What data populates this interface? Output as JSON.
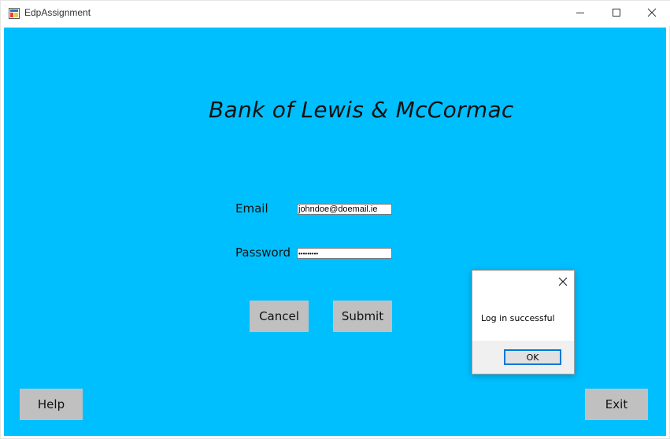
{
  "window": {
    "title": "EdpAssignment",
    "icon": "winforms-app-icon",
    "controls": [
      "minimize-icon",
      "maximize-icon",
      "close-icon"
    ]
  },
  "colors": {
    "background": "#00bfff",
    "button": "#c0c0c0",
    "dialog_focus": "#0078d7"
  },
  "form": {
    "heading": "Bank of Lewis & McCormac",
    "email_label": "Email",
    "email_value": "johndoe@doemail.ie",
    "password_label": "Password",
    "password_value": "•••••••••",
    "cancel_label": "Cancel",
    "submit_label": "Submit",
    "help_label": "Help",
    "exit_label": "Exit"
  },
  "dialog": {
    "message": "Log in successful",
    "ok_label": "OK"
  }
}
